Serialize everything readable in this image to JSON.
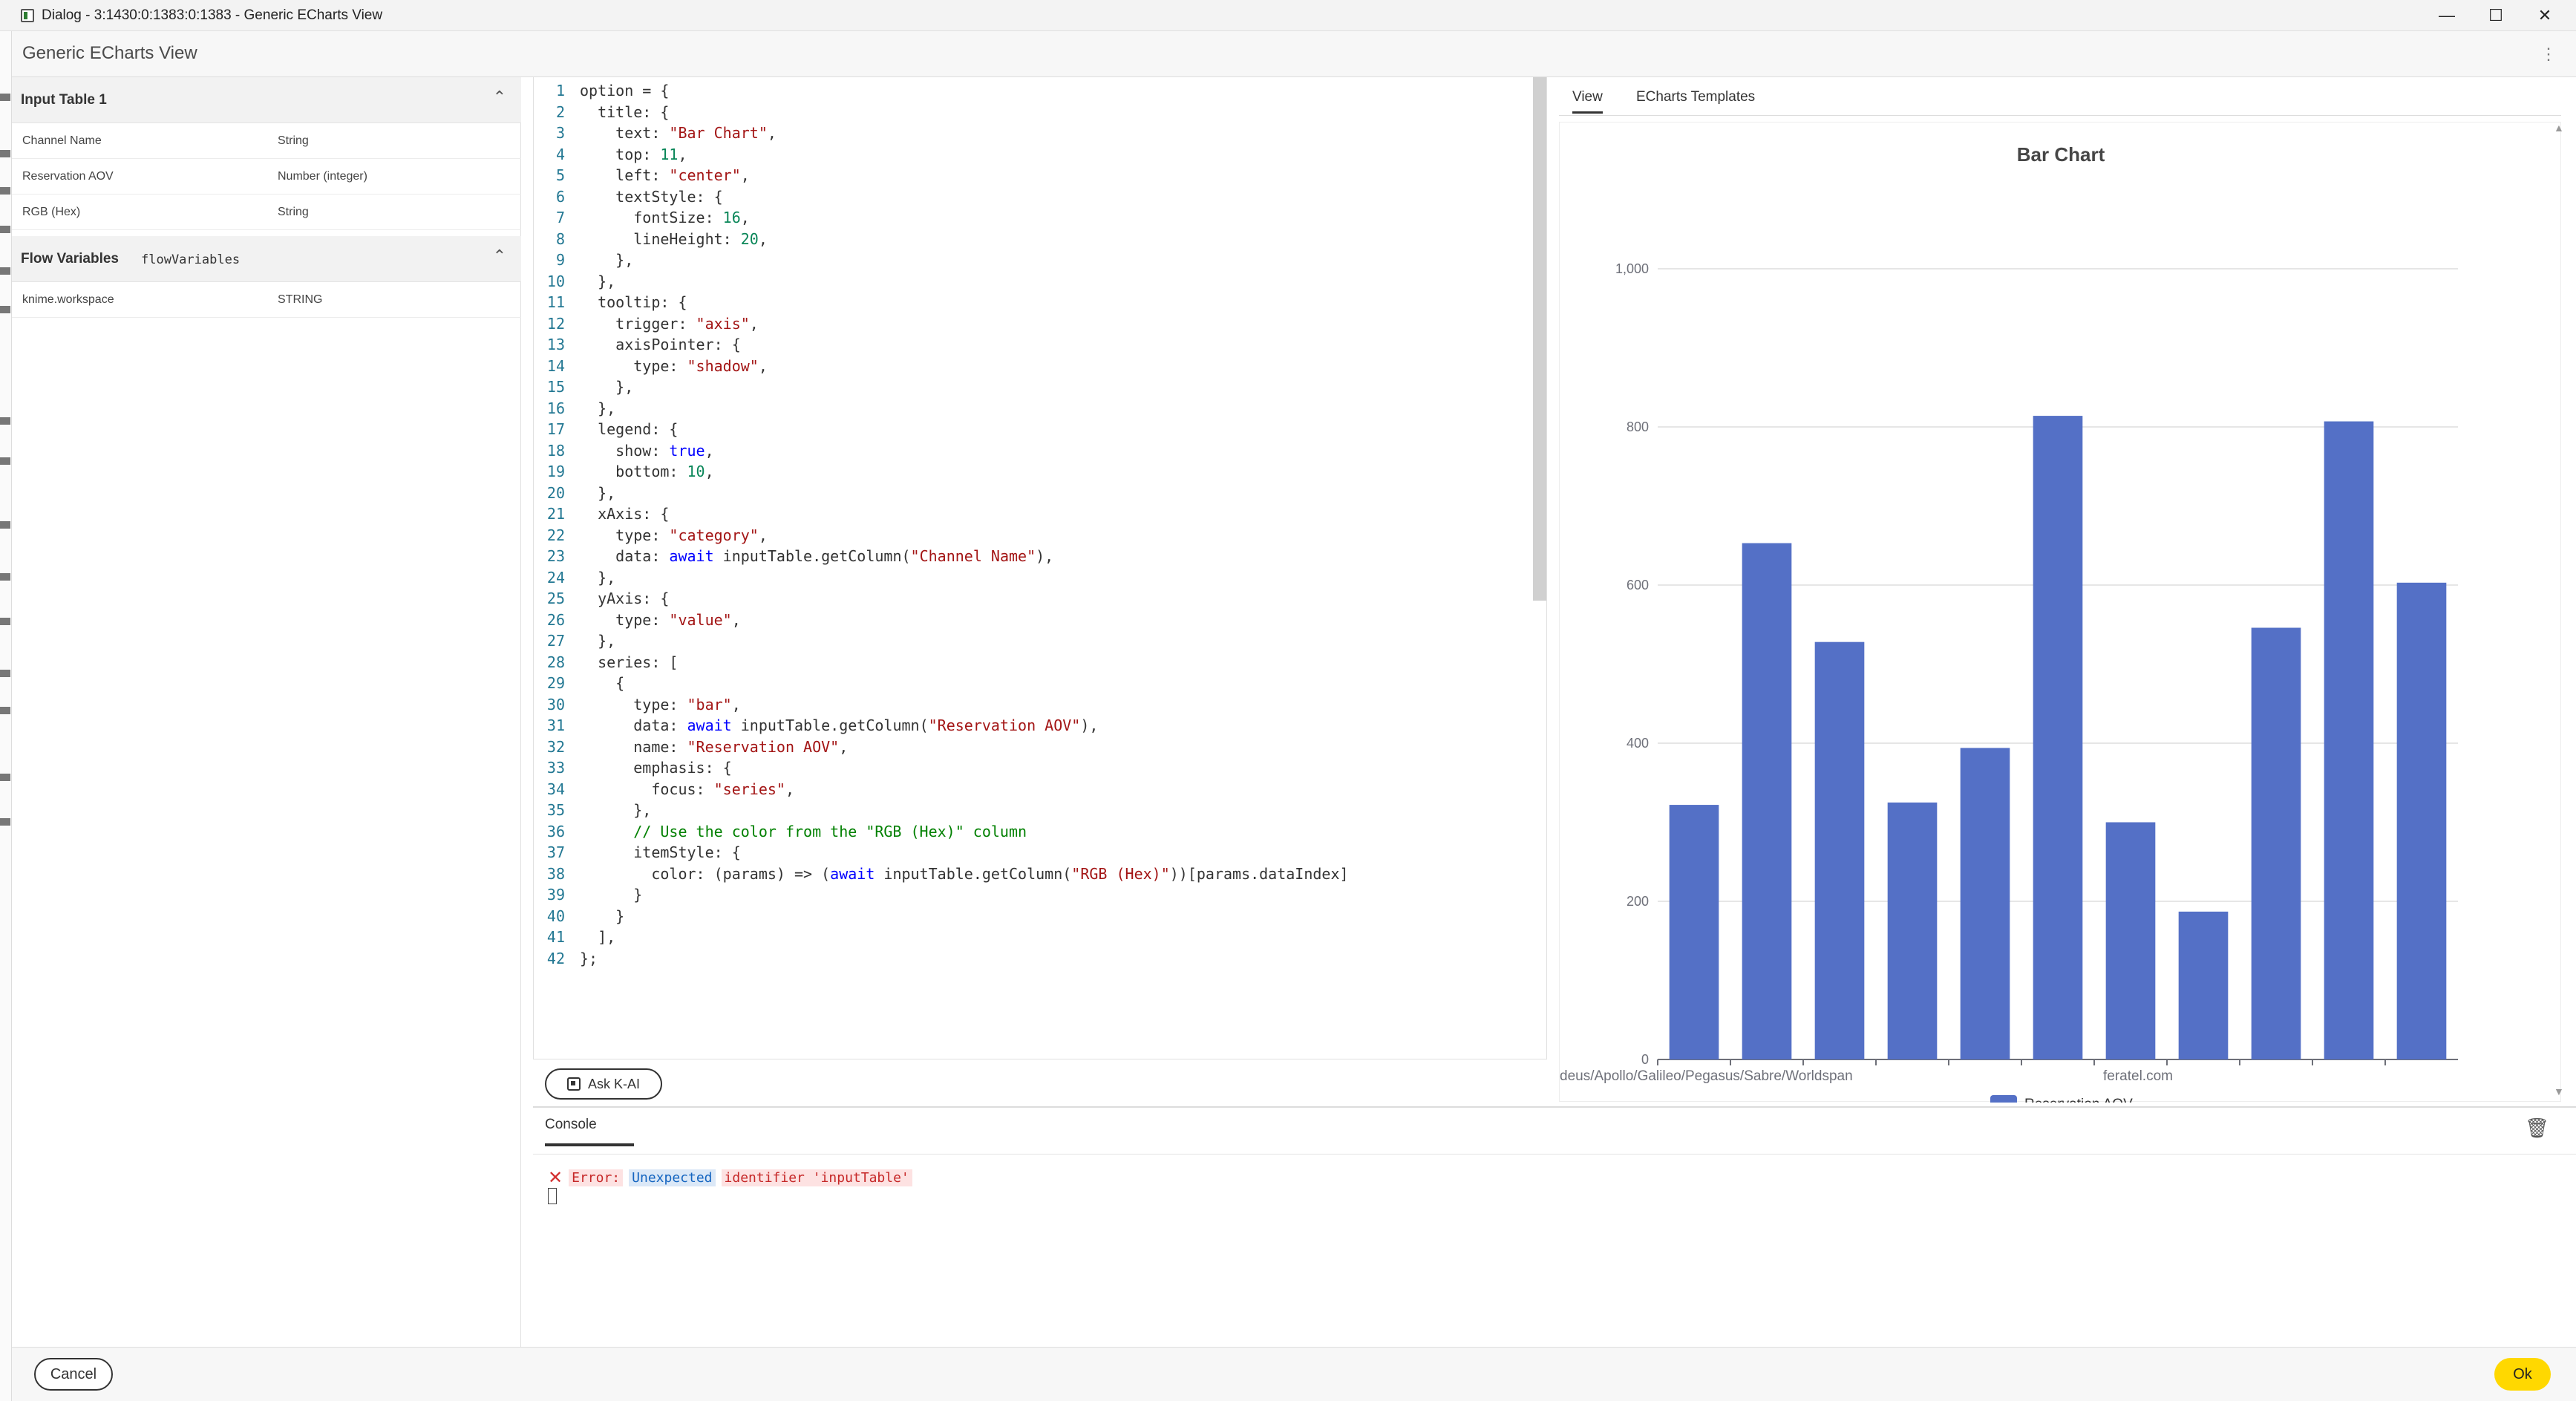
{
  "window": {
    "title": "Dialog - 3:1430:0:1383:0:1383 - Generic ECharts View"
  },
  "header": {
    "title": "Generic ECharts View"
  },
  "left": {
    "input_table": {
      "title": "Input Table 1",
      "columns": [
        {
          "name": "Channel Name",
          "type": "String"
        },
        {
          "name": "Reservation AOV",
          "type": "Number (integer)"
        },
        {
          "name": "RGB (Hex)",
          "type": "String"
        }
      ]
    },
    "flow_variables": {
      "title": "Flow Variables",
      "name": "flowVariables",
      "items": [
        {
          "name": "knime.workspace",
          "type": "STRING"
        }
      ]
    }
  },
  "code": {
    "lines": [
      "option = {",
      "  title: {",
      "    text: \"Bar Chart\",",
      "    top: 11,",
      "    left: \"center\",",
      "    textStyle: {",
      "      fontSize: 16,",
      "      lineHeight: 20,",
      "    },",
      "  },",
      "  tooltip: {",
      "    trigger: \"axis\",",
      "    axisPointer: {",
      "      type: \"shadow\",",
      "    },",
      "  },",
      "  legend: {",
      "    show: true,",
      "    bottom: 10,",
      "  },",
      "  xAxis: {",
      "    type: \"category\",",
      "    data: await inputTable.getColumn(\"Channel Name\"),",
      "  },",
      "  yAxis: {",
      "    type: \"value\",",
      "  },",
      "  series: [",
      "    {",
      "      type: \"bar\",",
      "      data: await inputTable.getColumn(\"Reservation AOV\"),",
      "      name: \"Reservation AOV\",",
      "      emphasis: {",
      "        focus: \"series\",",
      "      },",
      "      // Use the color from the \"RGB (Hex)\" column",
      "      itemStyle: {",
      "        color: (params) => (await inputTable.getColumn(\"RGB (Hex)\"))[params.dataIndex]",
      "      }",
      "    }",
      "  ],",
      "};"
    ]
  },
  "ask_button": {
    "label": "Ask K-AI"
  },
  "tabs": [
    {
      "label": "View"
    },
    {
      "label": "ECharts Templates"
    }
  ],
  "chart_data": {
    "type": "bar",
    "title": "Bar Chart",
    "categories": [
      "",
      "",
      "",
      "",
      "",
      "",
      "",
      "",
      "",
      "",
      "",
      ""
    ],
    "tick_labels": [
      "deus/Apollo/Galileo/Pegasus/Sabre/Worldspan",
      "feratel.com"
    ],
    "series": [
      {
        "name": "Reservation AOV",
        "color": "#5470c6",
        "values": [
          322,
          653,
          528,
          325,
          394,
          814,
          300,
          187,
          546,
          807,
          603
        ]
      }
    ],
    "yticks": [
      "0",
      "200",
      "400",
      "600",
      "800",
      "1,000"
    ],
    "ylim": [
      0,
      1000
    ],
    "grid": true,
    "legend": "bottom-center"
  },
  "console": {
    "tab_label": "Console",
    "error_prefix": "Error:",
    "error_mid": "Unexpected",
    "error_rest": "identifier 'inputTable'"
  },
  "footer": {
    "cancel_label": "Cancel",
    "ok_label": "Ok"
  }
}
